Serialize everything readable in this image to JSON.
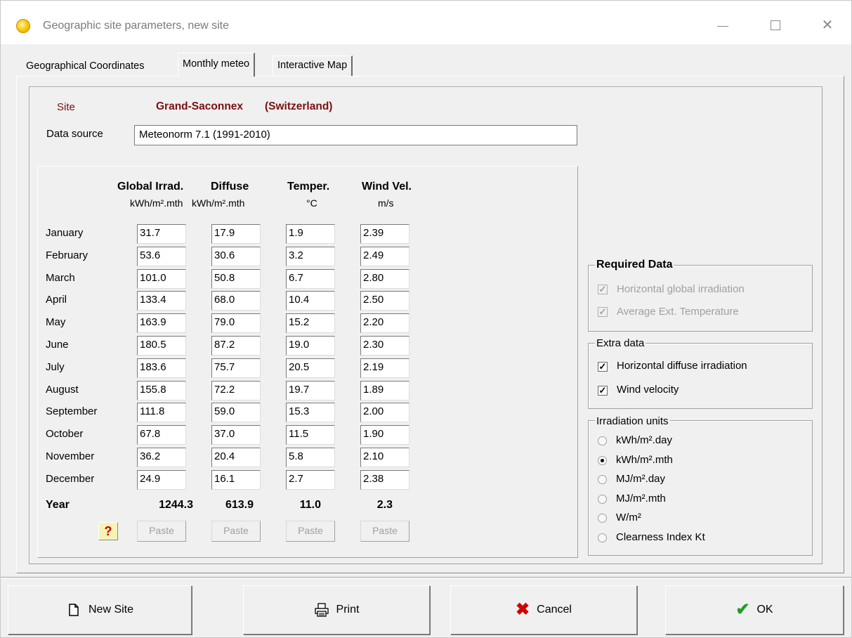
{
  "window": {
    "title": "Geographic site parameters, new site"
  },
  "tabs": [
    {
      "label": "Geographical Coordinates"
    },
    {
      "label": "Monthly meteo"
    },
    {
      "label": "Interactive Map"
    }
  ],
  "site": {
    "label": "Site",
    "name": "Grand-Saconnex",
    "country": "(Switzerland)"
  },
  "data_source": {
    "label": "Data source",
    "value": "Meteonorm 7.1 (1991-2010)"
  },
  "columns": [
    {
      "header": "Global Irrad.",
      "unit": "kWh/m².mth"
    },
    {
      "header": "Diffuse",
      "unit": "kWh/m².mth"
    },
    {
      "header": "Temper.",
      "unit": "°C"
    },
    {
      "header": "Wind Vel.",
      "unit": "m/s"
    }
  ],
  "rows": [
    {
      "month": "January",
      "values": [
        "31.7",
        "17.9",
        "1.9",
        "2.39"
      ]
    },
    {
      "month": "February",
      "values": [
        "53.6",
        "30.6",
        "3.2",
        "2.49"
      ]
    },
    {
      "month": "March",
      "values": [
        "101.0",
        "50.8",
        "6.7",
        "2.80"
      ]
    },
    {
      "month": "April",
      "values": [
        "133.4",
        "68.0",
        "10.4",
        "2.50"
      ]
    },
    {
      "month": "May",
      "values": [
        "163.9",
        "79.0",
        "15.2",
        "2.20"
      ]
    },
    {
      "month": "June",
      "values": [
        "180.5",
        "87.2",
        "19.0",
        "2.30"
      ]
    },
    {
      "month": "July",
      "values": [
        "183.6",
        "75.7",
        "20.5",
        "2.19"
      ]
    },
    {
      "month": "August",
      "values": [
        "155.8",
        "72.2",
        "19.7",
        "1.89"
      ]
    },
    {
      "month": "September",
      "values": [
        "111.8",
        "59.0",
        "15.3",
        "2.00"
      ]
    },
    {
      "month": "October",
      "values": [
        "67.8",
        "37.0",
        "11.5",
        "1.90"
      ]
    },
    {
      "month": "November",
      "values": [
        "36.2",
        "20.4",
        "5.8",
        "2.10"
      ]
    },
    {
      "month": "December",
      "values": [
        "24.9",
        "16.1",
        "2.7",
        "2.38"
      ]
    }
  ],
  "year": {
    "label": "Year",
    "values": [
      "1244.3",
      "613.9",
      "11.0",
      "2.3"
    ]
  },
  "paste_label": "Paste",
  "help_label": "?",
  "required_data": {
    "title": "Required Data",
    "items": [
      {
        "label": "Horizontal global irradiation",
        "checked": true,
        "enabled": false
      },
      {
        "label": "Average Ext. Temperature",
        "checked": true,
        "enabled": false
      }
    ]
  },
  "extra_data": {
    "title": "Extra data",
    "items": [
      {
        "label": "Horizontal diffuse irradiation",
        "checked": true
      },
      {
        "label": "Wind velocity",
        "checked": true
      }
    ]
  },
  "irradiation_units": {
    "title": "Irradiation units",
    "selected": "kWh/m².mth",
    "options": [
      "kWh/m².day",
      "kWh/m².mth",
      "MJ/m².day",
      "MJ/m².mth",
      "W/m²",
      "Clearness Index Kt"
    ]
  },
  "buttons": {
    "new_site": "New Site",
    "print": "Print",
    "cancel": "Cancel",
    "ok": "OK"
  },
  "icons": {
    "app": "sun-icon",
    "new_site": "new-document-icon",
    "print": "printer-icon",
    "cancel": "red-cross-icon",
    "ok": "green-check-icon"
  },
  "colors": {
    "site_text": "#7a1010",
    "cancel_icon": "#d40000",
    "ok_icon": "#1f9e1f",
    "help_bg": "#f7f3b6",
    "disabled_text": "#a0a0a0"
  }
}
